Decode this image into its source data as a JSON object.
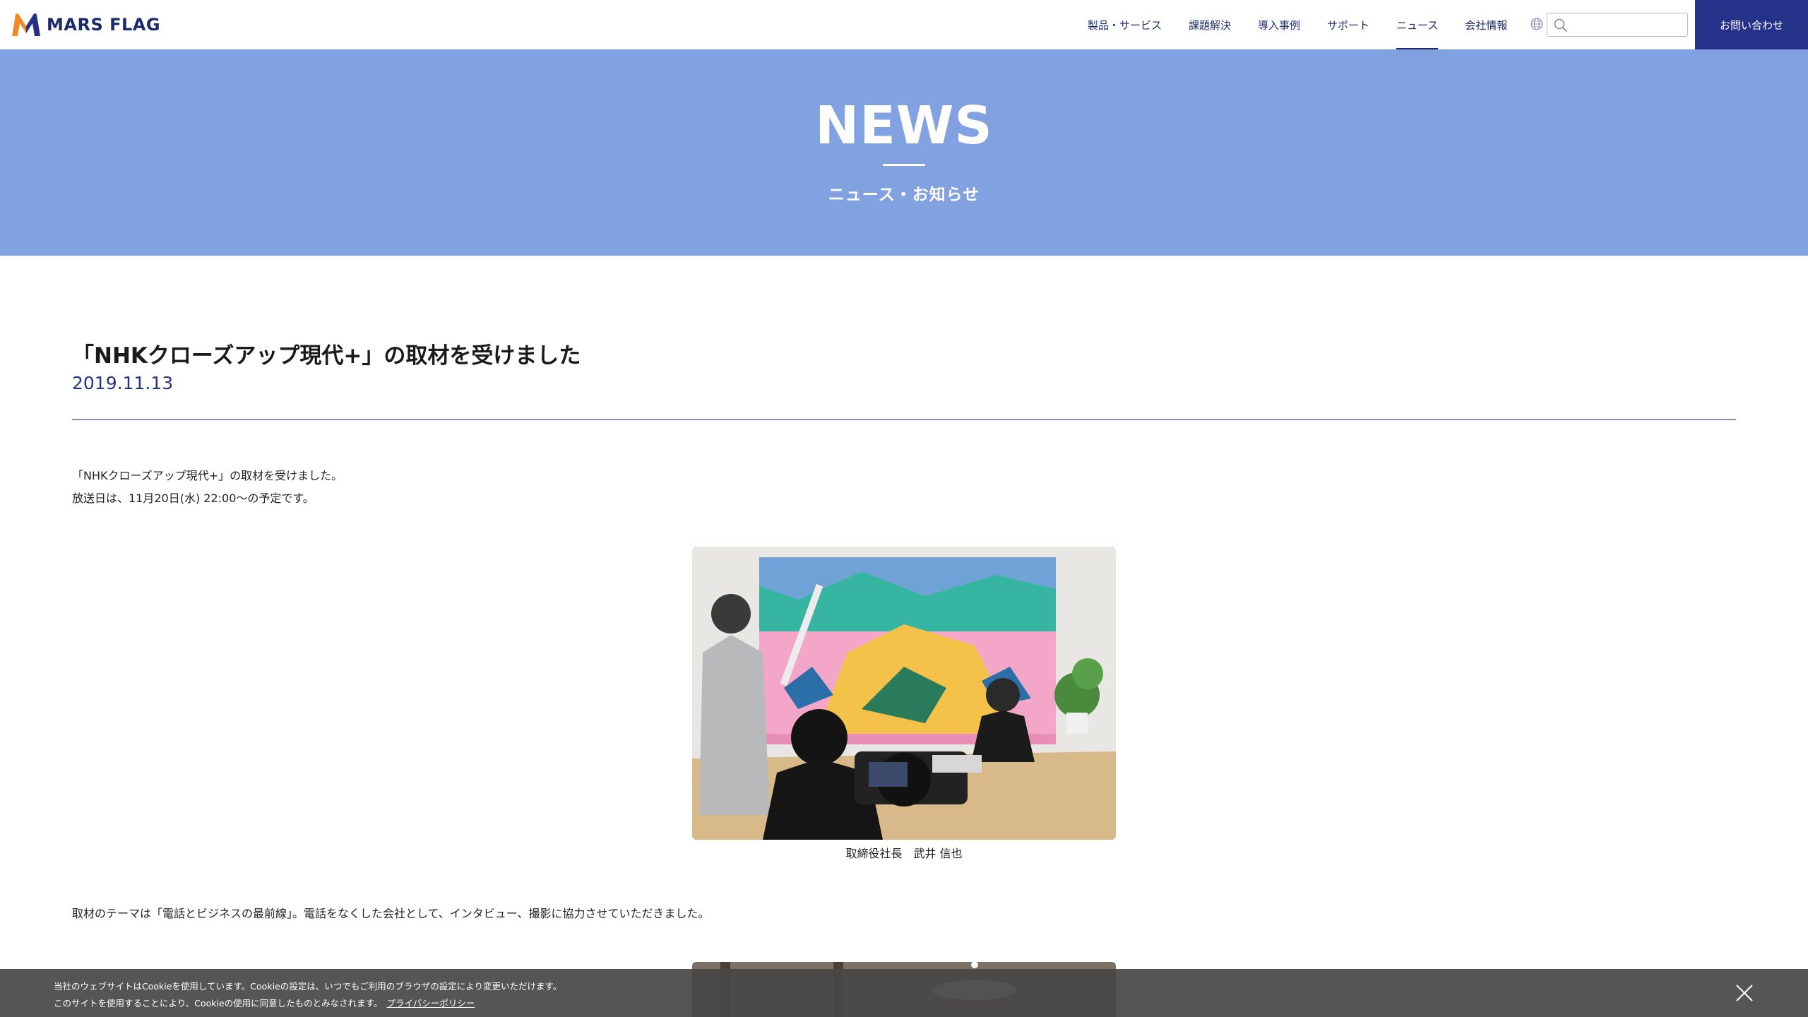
{
  "header": {
    "logo_text": "MARS FLAG",
    "nav": [
      {
        "label": "製品・サービス",
        "name": "products-services"
      },
      {
        "label": "課題解決",
        "name": "solutions"
      },
      {
        "label": "導入事例",
        "name": "case-studies"
      },
      {
        "label": "サポート",
        "name": "support"
      },
      {
        "label": "ニュース",
        "name": "news",
        "active": true
      },
      {
        "label": "会社情報",
        "name": "company"
      }
    ],
    "search_value": "",
    "contact_label": "お問い合わせ"
  },
  "hero": {
    "title": "NEWS",
    "subtitle": "ニュース・お知らせ"
  },
  "article": {
    "title": "「NHKクローズアップ現代+」の取材を受けました",
    "date": "2019.11.13",
    "paragraphs": [
      "「NHKクローズアップ現代+」の取材を受けました。",
      "放送日は、11月20日(水) 22:00～の予定です。",
      "取材のテーマは「電話とビジネスの最前線」。電話をなくした会社として、インタビュー、撮影に協力させていただきました。"
    ],
    "photo_caption": "取締役社長　武井 信也"
  },
  "cookie": {
    "line1": "当社のウェブサイトはCookieを使用しています。Cookieの設定は、いつでもご利用のブラウザの設定により変更いただけます。",
    "line2": "このサイトを使用することにより、Cookieの使用に同意したものとみなされます。",
    "link_label": "プライバシーポリシー"
  },
  "colors": {
    "brand_navy": "#26318a",
    "hero_blue": "#82a1e0",
    "logo_orange": "#f08a24"
  }
}
